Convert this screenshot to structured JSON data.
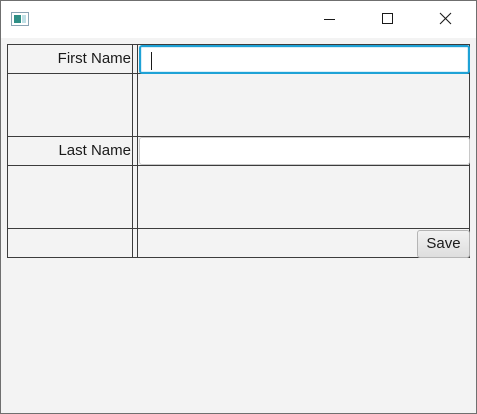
{
  "window": {
    "icon": "app-window-icon",
    "controls": [
      "minimize-icon",
      "maximize-icon",
      "close-icon"
    ]
  },
  "form": {
    "first_name_label": "First Name",
    "first_name_value": "",
    "last_name_label": "Last Name",
    "last_name_value": "",
    "save_label": "Save"
  },
  "colors": {
    "background": "#f3f3f3",
    "focus_border": "#1ea2d6",
    "grid_lines": "#3c3c3c"
  }
}
